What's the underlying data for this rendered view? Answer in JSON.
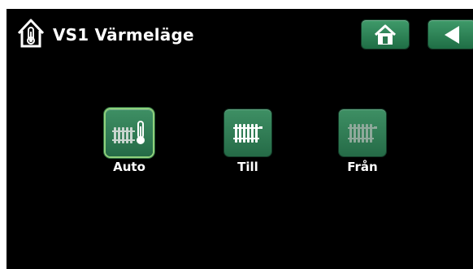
{
  "header": {
    "title": "VS1 Värmeläge",
    "icon": "house-thermometer-icon"
  },
  "nav": {
    "home_icon": "home-icon",
    "back_icon": "back-arrow-icon"
  },
  "modes": [
    {
      "label": "Auto",
      "icon": "radiator-thermometer-icon",
      "selected": true
    },
    {
      "label": "Till",
      "icon": "radiator-on-icon",
      "selected": false
    },
    {
      "label": "Från",
      "icon": "radiator-off-icon",
      "selected": false
    }
  ],
  "colors": {
    "background": "#000000",
    "button_green": "#2e7d52",
    "selected_outline": "#8fd17c",
    "text": "#ffffff"
  }
}
